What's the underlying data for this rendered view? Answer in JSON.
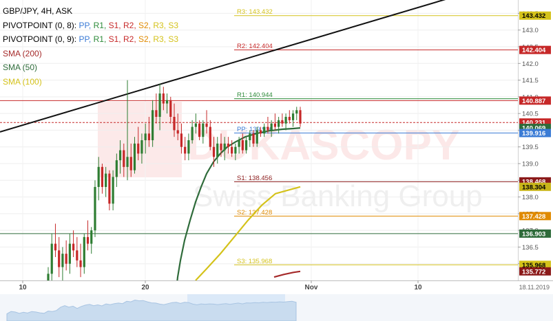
{
  "legend": {
    "symbol_line": "GBP/JPY, 4H, ASK",
    "pivot_lines": [
      {
        "label": "PIVOTPOINT (0, 8):",
        "items": [
          "PP",
          "R1",
          "S1",
          "R2",
          "S2",
          "R3",
          "S3"
        ]
      },
      {
        "label": "PIVOTPOINT (0, 9):",
        "items": [
          "PP",
          "R1",
          "S1",
          "R2",
          "S2",
          "R3",
          "S3"
        ]
      }
    ],
    "sma": [
      {
        "label": "SMA (200)",
        "color": "#a52a2a"
      },
      {
        "label": "SMA (50)",
        "color": "#2e6b3a"
      },
      {
        "label": "SMA (100)",
        "color": "#d4c21a"
      }
    ],
    "item_colors": {
      "PP": "#3a7bd5",
      "R1": "#2e8b3a",
      "S1": "#c62828",
      "R2": "#c62828",
      "S2": "#e08a00",
      "R3": "#d4c21a",
      "S3": "#d4c21a"
    }
  },
  "watermark": {
    "brand": "DUKASCOPY",
    "sub": "Swiss Banking Group"
  },
  "colors": {
    "bull": "#2e7d32",
    "bear": "#c62828"
  },
  "chart_data": {
    "type": "candlestick",
    "title": "GBP/JPY, 4H, ASK",
    "ylim": [
      135.5,
      143.9
    ],
    "y_ticks": [
      136.0,
      136.5,
      137.0,
      137.5,
      138.0,
      138.5,
      139.0,
      139.5,
      140.0,
      140.5,
      141.0,
      141.5,
      142.0,
      142.5,
      143.0,
      143.5
    ],
    "x_ticks": [
      "10",
      "20",
      "Nov",
      "10"
    ],
    "date_label": "18.11.2019",
    "pivot_levels": [
      {
        "label": "R3: 143.432",
        "value": 143.432,
        "color": "#d4c21a"
      },
      {
        "label": "R2: 142.404",
        "value": 142.404,
        "color": "#c62828"
      },
      {
        "label": "R1: 140.944",
        "value": 140.944,
        "color": "#2e8b3a"
      },
      {
        "label": "PP: 139.916",
        "value": 139.916,
        "color": "#3a7bd5"
      },
      {
        "label": "S1: 138.456",
        "value": 138.456,
        "color": "#8b1a1a"
      },
      {
        "label": "S2: 137.428",
        "value": 137.428,
        "color": "#e08a00"
      },
      {
        "label": "S3: 135.968",
        "value": 135.968,
        "color": "#d4c21a"
      }
    ],
    "price_badges": [
      {
        "text": "143.432",
        "value": 143.432,
        "bg": "#d4c21a",
        "fg": "#000000"
      },
      {
        "text": "142.404",
        "value": 142.404,
        "bg": "#c62828",
        "fg": "#ffffff"
      },
      {
        "text": "140.887",
        "value": 140.887,
        "bg": "#c62828",
        "fg": "#ffffff"
      },
      {
        "text": "140.231",
        "value": 140.231,
        "bg": "#c62828",
        "fg": "#ffffff"
      },
      {
        "text": "140.069",
        "value": 140.069,
        "bg": "#2e6b3a",
        "fg": "#ffffff"
      },
      {
        "text": "139.916",
        "value": 139.916,
        "bg": "#3a7bd5",
        "fg": "#ffffff"
      },
      {
        "text": "138.468",
        "value": 138.468,
        "bg": "#8b1a1a",
        "fg": "#ffffff"
      },
      {
        "text": "138.304",
        "value": 138.304,
        "bg": "#c9b61a",
        "fg": "#000000"
      },
      {
        "text": "137.428",
        "value": 137.428,
        "bg": "#e08a00",
        "fg": "#ffffff"
      },
      {
        "text": "136.903",
        "value": 136.903,
        "bg": "#2e6b3a",
        "fg": "#ffffff"
      },
      {
        "text": "135.968",
        "value": 135.968,
        "bg": "#d4c21a",
        "fg": "#000000"
      },
      {
        "text": "135.772",
        "value": 135.772,
        "bg": "#8b1a1a",
        "fg": "#ffffff"
      }
    ],
    "horizontal_lines": [
      {
        "value": 140.887,
        "color": "#c62828",
        "style": "solid"
      },
      {
        "value": 140.231,
        "color": "#c62828",
        "style": "dashed"
      },
      {
        "value": 136.903,
        "color": "#2e6b3a",
        "style": "solid"
      }
    ],
    "candles": [
      {
        "o": 134.9,
        "h": 135.9,
        "l": 134.5,
        "c": 135.7
      },
      {
        "o": 135.7,
        "h": 136.9,
        "l": 135.3,
        "c": 136.6
      },
      {
        "o": 136.6,
        "h": 137.2,
        "l": 136.2,
        "c": 136.4
      },
      {
        "o": 136.4,
        "h": 136.8,
        "l": 135.6,
        "c": 135.9
      },
      {
        "o": 135.9,
        "h": 136.5,
        "l": 135.5,
        "c": 136.3
      },
      {
        "o": 136.3,
        "h": 136.7,
        "l": 135.8,
        "c": 136.0
      },
      {
        "o": 136.0,
        "h": 136.9,
        "l": 135.7,
        "c": 136.6
      },
      {
        "o": 136.6,
        "h": 137.0,
        "l": 136.2,
        "c": 136.4
      },
      {
        "o": 136.4,
        "h": 136.8,
        "l": 135.9,
        "c": 136.1
      },
      {
        "o": 136.1,
        "h": 136.6,
        "l": 135.6,
        "c": 135.9
      },
      {
        "o": 135.9,
        "h": 136.9,
        "l": 135.7,
        "c": 136.8
      },
      {
        "o": 136.8,
        "h": 137.3,
        "l": 136.4,
        "c": 136.6
      },
      {
        "o": 136.6,
        "h": 137.1,
        "l": 136.3,
        "c": 137.0
      },
      {
        "o": 137.0,
        "h": 138.5,
        "l": 136.8,
        "c": 138.3
      },
      {
        "o": 138.3,
        "h": 139.2,
        "l": 137.9,
        "c": 138.9
      },
      {
        "o": 138.9,
        "h": 139.0,
        "l": 138.1,
        "c": 138.3
      },
      {
        "o": 138.3,
        "h": 138.9,
        "l": 138.0,
        "c": 138.7
      },
      {
        "o": 138.7,
        "h": 138.8,
        "l": 137.6,
        "c": 137.8
      },
      {
        "o": 137.8,
        "h": 138.8,
        "l": 137.6,
        "c": 138.6
      },
      {
        "o": 138.6,
        "h": 139.3,
        "l": 138.3,
        "c": 139.1
      },
      {
        "o": 139.1,
        "h": 139.7,
        "l": 138.7,
        "c": 139.4
      },
      {
        "o": 139.4,
        "h": 139.6,
        "l": 138.6,
        "c": 138.9
      },
      {
        "o": 138.9,
        "h": 141.5,
        "l": 138.5,
        "c": 139.2
      },
      {
        "o": 139.2,
        "h": 139.6,
        "l": 138.6,
        "c": 138.8
      },
      {
        "o": 138.8,
        "h": 139.8,
        "l": 138.7,
        "c": 139.6
      },
      {
        "o": 139.6,
        "h": 140.1,
        "l": 139.1,
        "c": 139.3
      },
      {
        "o": 139.3,
        "h": 139.9,
        "l": 139.0,
        "c": 139.7
      },
      {
        "o": 139.7,
        "h": 140.2,
        "l": 139.3,
        "c": 139.9
      },
      {
        "o": 139.9,
        "h": 140.4,
        "l": 139.5,
        "c": 139.7
      },
      {
        "o": 139.7,
        "h": 140.9,
        "l": 139.5,
        "c": 140.6
      },
      {
        "o": 140.6,
        "h": 141.1,
        "l": 140.2,
        "c": 140.4
      },
      {
        "o": 140.4,
        "h": 141.4,
        "l": 140.0,
        "c": 141.1
      },
      {
        "o": 141.1,
        "h": 141.3,
        "l": 140.6,
        "c": 140.8
      },
      {
        "o": 140.8,
        "h": 141.1,
        "l": 140.5,
        "c": 140.9
      },
      {
        "o": 140.9,
        "h": 141.0,
        "l": 140.2,
        "c": 140.4
      },
      {
        "o": 140.4,
        "h": 140.8,
        "l": 139.8,
        "c": 140.0
      },
      {
        "o": 140.0,
        "h": 140.5,
        "l": 139.7,
        "c": 139.9
      },
      {
        "o": 139.9,
        "h": 140.2,
        "l": 139.3,
        "c": 139.5
      },
      {
        "o": 139.5,
        "h": 139.8,
        "l": 139.1,
        "c": 139.3
      },
      {
        "o": 139.3,
        "h": 139.9,
        "l": 139.1,
        "c": 139.7
      },
      {
        "o": 139.7,
        "h": 140.3,
        "l": 139.6,
        "c": 140.1
      },
      {
        "o": 140.1,
        "h": 140.5,
        "l": 139.9,
        "c": 140.2
      },
      {
        "o": 140.2,
        "h": 140.3,
        "l": 139.7,
        "c": 139.8
      },
      {
        "o": 139.8,
        "h": 140.3,
        "l": 139.6,
        "c": 140.2
      },
      {
        "o": 140.2,
        "h": 140.6,
        "l": 139.9,
        "c": 140.1
      },
      {
        "o": 140.1,
        "h": 140.3,
        "l": 139.4,
        "c": 139.5
      },
      {
        "o": 139.5,
        "h": 139.8,
        "l": 138.9,
        "c": 139.2
      },
      {
        "o": 139.2,
        "h": 139.8,
        "l": 139.0,
        "c": 139.6
      },
      {
        "o": 139.6,
        "h": 139.9,
        "l": 139.2,
        "c": 139.4
      },
      {
        "o": 139.4,
        "h": 139.8,
        "l": 139.1,
        "c": 139.6
      },
      {
        "o": 139.6,
        "h": 139.8,
        "l": 139.3,
        "c": 139.5
      },
      {
        "o": 139.5,
        "h": 139.7,
        "l": 139.2,
        "c": 139.3
      },
      {
        "o": 139.3,
        "h": 139.6,
        "l": 139.1,
        "c": 139.5
      },
      {
        "o": 139.5,
        "h": 139.8,
        "l": 139.3,
        "c": 139.7
      },
      {
        "o": 139.7,
        "h": 139.9,
        "l": 139.3,
        "c": 139.4
      },
      {
        "o": 139.4,
        "h": 139.8,
        "l": 139.3,
        "c": 139.7
      },
      {
        "o": 139.7,
        "h": 140.0,
        "l": 139.5,
        "c": 139.9
      },
      {
        "o": 139.9,
        "h": 140.0,
        "l": 139.5,
        "c": 139.6
      },
      {
        "o": 139.6,
        "h": 140.1,
        "l": 139.5,
        "c": 140.0
      },
      {
        "o": 140.0,
        "h": 140.1,
        "l": 139.8,
        "c": 139.9
      },
      {
        "o": 139.9,
        "h": 140.2,
        "l": 139.8,
        "c": 140.1
      },
      {
        "o": 140.1,
        "h": 140.4,
        "l": 139.9,
        "c": 140.0
      },
      {
        "o": 140.0,
        "h": 140.3,
        "l": 139.8,
        "c": 140.2
      },
      {
        "o": 140.2,
        "h": 140.5,
        "l": 140.0,
        "c": 140.1
      },
      {
        "o": 140.1,
        "h": 140.4,
        "l": 139.9,
        "c": 140.3
      },
      {
        "o": 140.3,
        "h": 140.5,
        "l": 140.1,
        "c": 140.2
      },
      {
        "o": 140.2,
        "h": 140.5,
        "l": 140.0,
        "c": 140.4
      },
      {
        "o": 140.4,
        "h": 140.6,
        "l": 140.2,
        "c": 140.3
      },
      {
        "o": 140.3,
        "h": 140.6,
        "l": 140.1,
        "c": 140.5
      },
      {
        "o": 140.5,
        "h": 140.7,
        "l": 140.3,
        "c": 140.6
      },
      {
        "o": 140.6,
        "h": 140.7,
        "l": 140.1,
        "c": 140.2
      }
    ]
  }
}
